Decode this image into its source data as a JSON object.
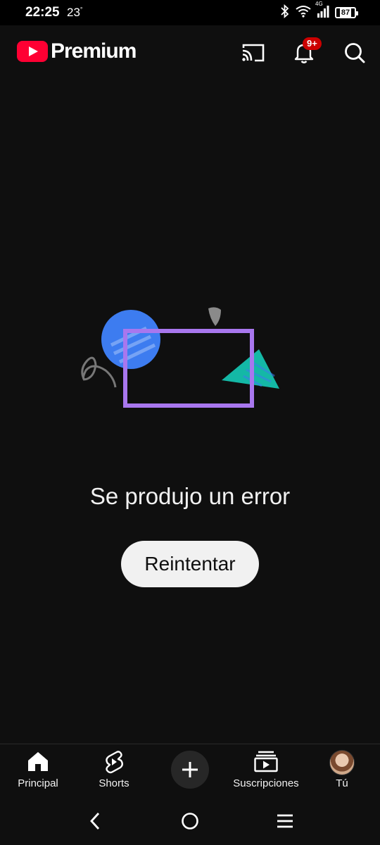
{
  "status_bar": {
    "time": "22:25",
    "temperature": "23",
    "temperature_unit": "°",
    "network_label": "4G",
    "battery": "87"
  },
  "header": {
    "logo_text": "Premium",
    "notification_badge": "9+"
  },
  "error": {
    "message": "Se produjo un error",
    "retry_label": "Reintentar"
  },
  "bottom_nav": {
    "items": [
      {
        "label": "Principal"
      },
      {
        "label": "Shorts"
      },
      {
        "label": "Suscripciones"
      },
      {
        "label": "Tú"
      }
    ]
  },
  "colors": {
    "background": "#0f0f0f",
    "brand_red": "#ff0033",
    "badge_red": "#cc0000",
    "illustration_blue": "#3d7cf0",
    "illustration_purple": "#a877ee",
    "illustration_teal": "#14b8a6"
  }
}
